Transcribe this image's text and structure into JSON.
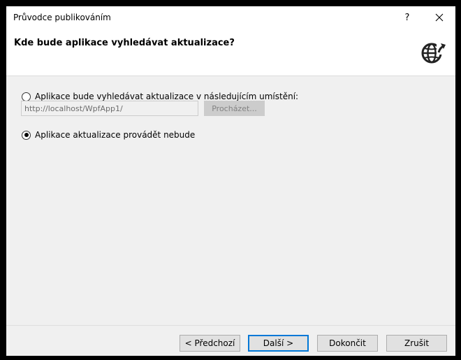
{
  "window": {
    "title": "Průvodce publikováním",
    "help_label": "?",
    "close_label": "✕"
  },
  "header": {
    "title": "Kde bude aplikace vyhledávat aktualizace?",
    "icon": "globe-arrow-icon"
  },
  "options": {
    "check_location": {
      "label": "Aplikace bude vyhledávat aktualizace v následujícím umístění:",
      "selected": false
    },
    "url_value": "http://localhost/WpfApp1/",
    "browse_label": "Procházet...",
    "no_updates": {
      "label": "Aplikace aktualizace provádět nebude",
      "selected": true
    }
  },
  "footer": {
    "prev_label": "< Předchozí",
    "next_label": "Další >",
    "finish_label": "Dokončit",
    "cancel_label": "Zrušit"
  },
  "colors": {
    "accent": "#0078d7",
    "dialog_bg": "#f0f0f0",
    "header_bg": "#ffffff"
  }
}
